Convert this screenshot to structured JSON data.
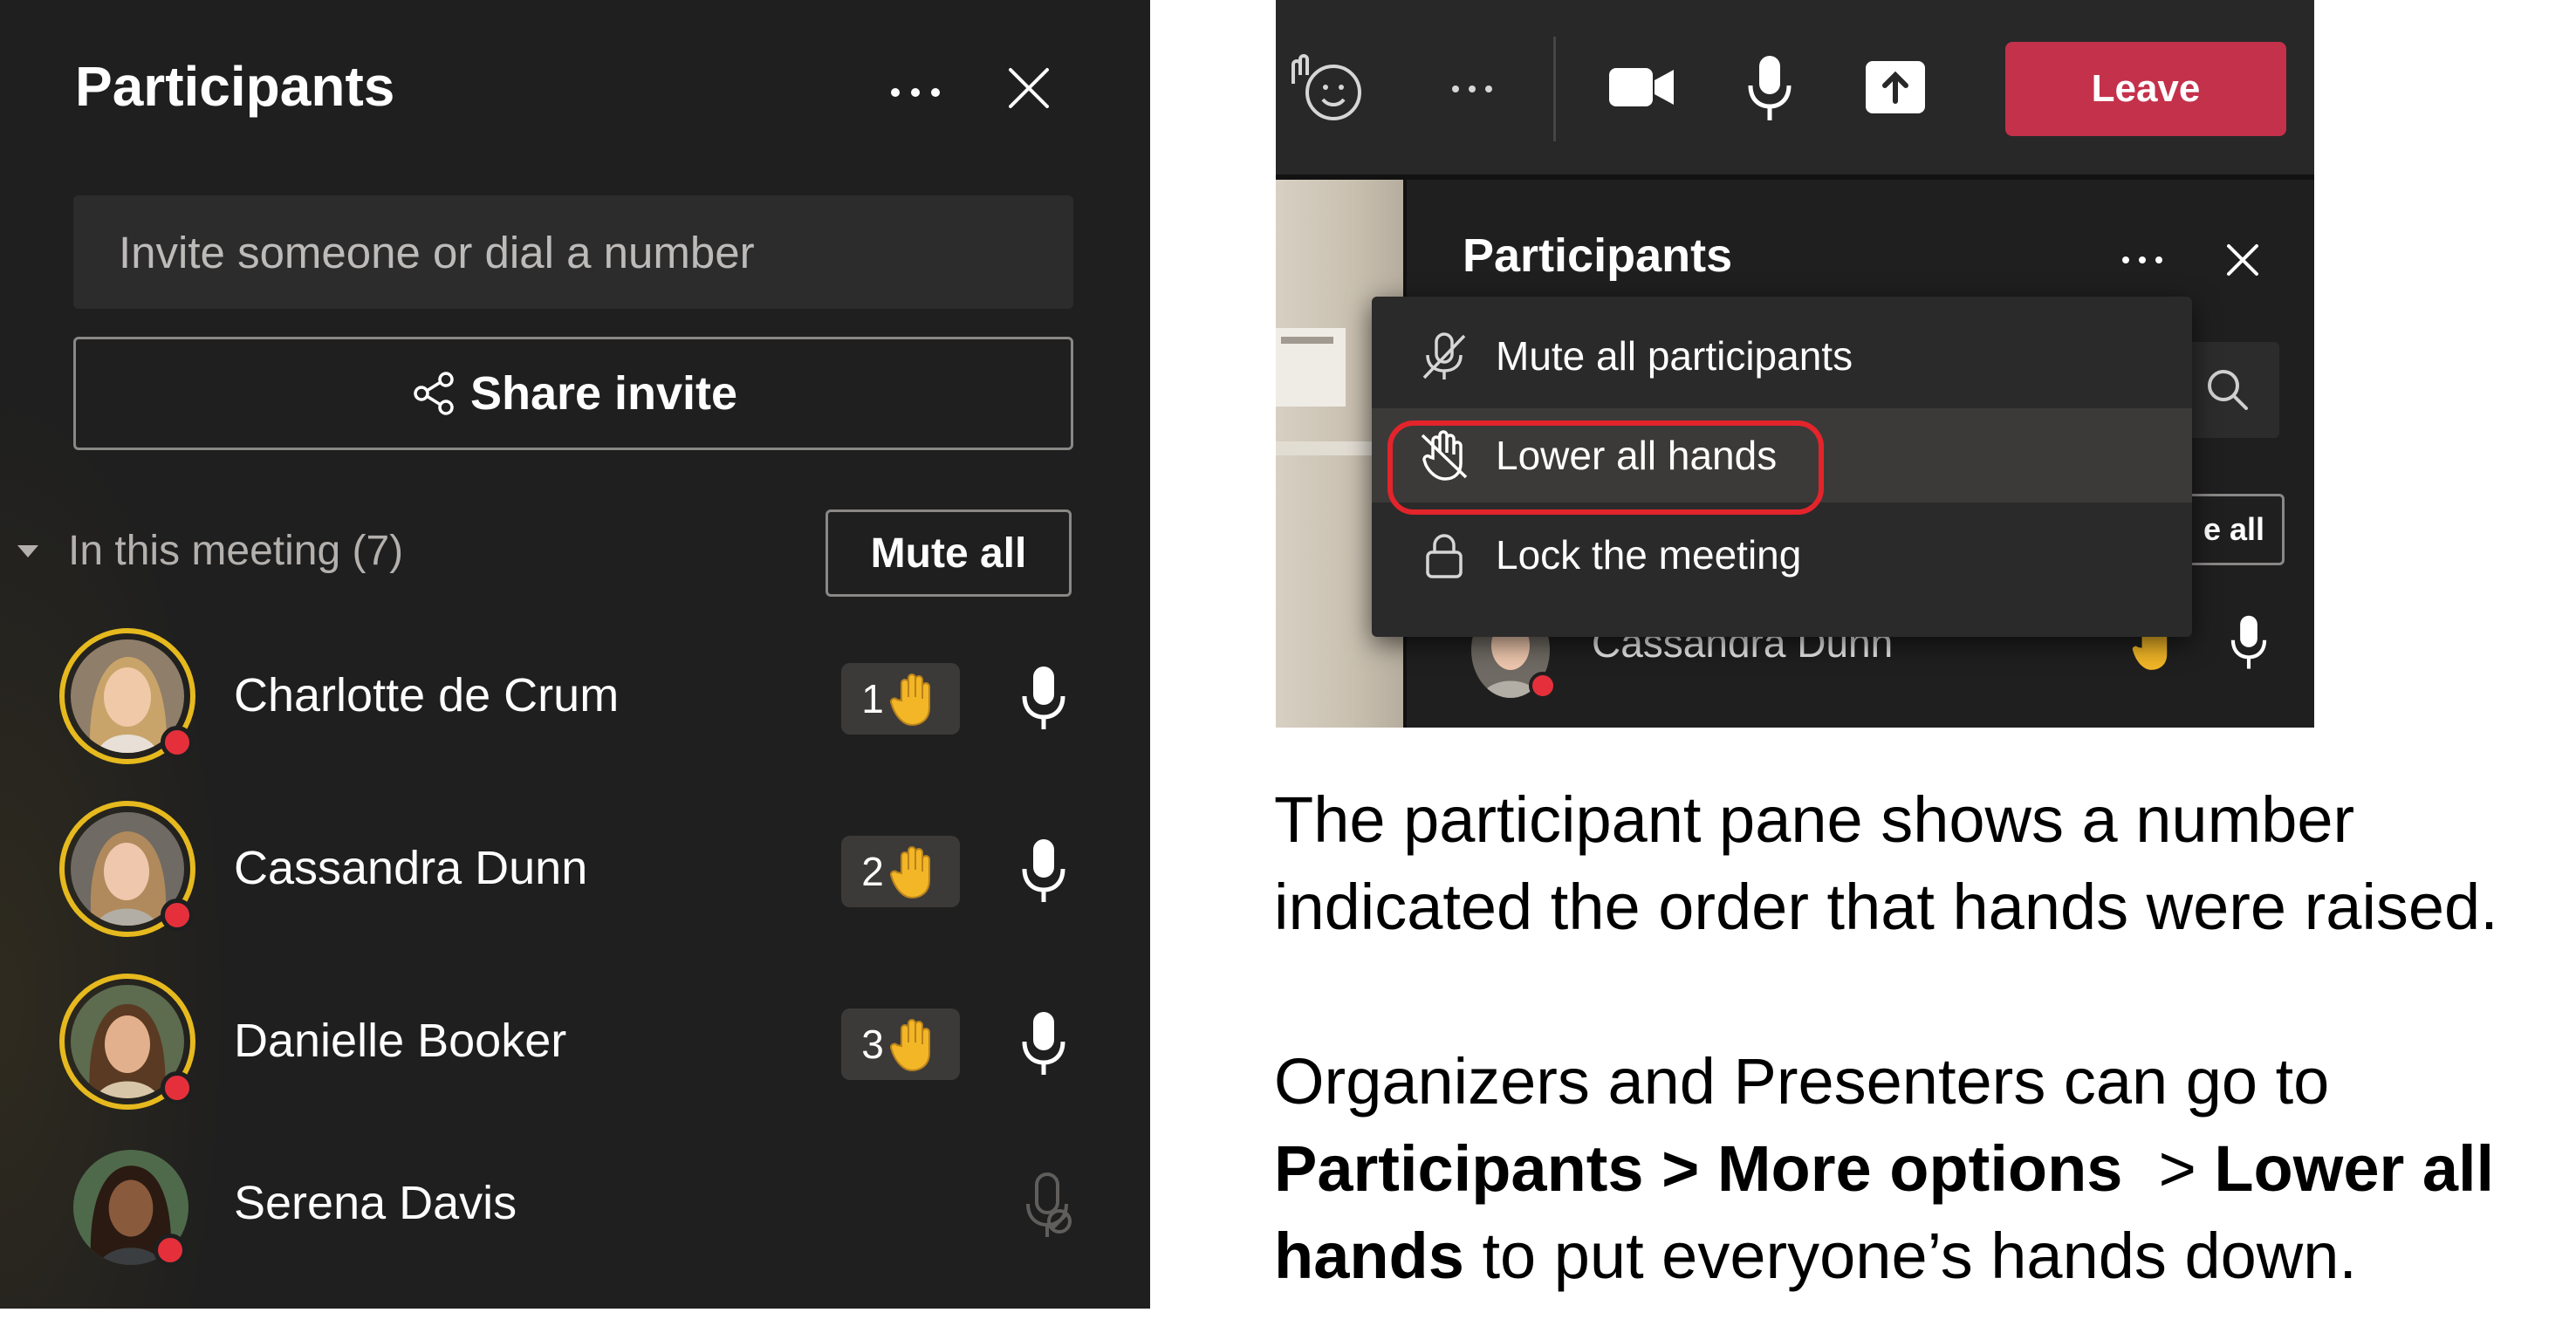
{
  "left_panel": {
    "title": "Participants",
    "invite_placeholder": "Invite someone or dial a number",
    "share_label": "Share invite",
    "section_label": "In this meeting (7)",
    "mute_all_label": "Mute all",
    "participants": [
      {
        "name": "Charlotte de Crum",
        "hand_order": "1",
        "hand_raised": true,
        "mic": "on"
      },
      {
        "name": "Cassandra Dunn",
        "hand_order": "2",
        "hand_raised": true,
        "mic": "on"
      },
      {
        "name": "Danielle Booker",
        "hand_order": "3",
        "hand_raised": true,
        "mic": "on"
      },
      {
        "name": "Serena Davis",
        "hand_order": "",
        "hand_raised": false,
        "mic": "off"
      }
    ]
  },
  "right_screenshot": {
    "leave_label": "Leave",
    "panel_title": "Participants",
    "menu": {
      "items": [
        {
          "label": "Mute all participants",
          "icon": "mic-off-icon"
        },
        {
          "label": "Lower all hands",
          "icon": "hand-off-icon",
          "highlighted": true
        },
        {
          "label": "Lock the meeting",
          "icon": "lock-icon"
        }
      ]
    },
    "mute_all_partial": "e all",
    "participant_name": "Cassandra Dunn"
  },
  "caption": {
    "para1": "The participant pane shows a number indicated the order that hands were raised.",
    "para2_prefix": "Organizers and Presenters can go to ",
    "para2_bold1": "Participants > More options",
    "para2_sep": "  > ",
    "para2_bold2": "Lower all hands",
    "para2_suffix": " to put everyone’s hands down."
  },
  "colors": {
    "panel_bg": "#1f1f1f",
    "ring": "#e6b91e",
    "status": "#e5303c",
    "leave": "#c4314b",
    "highlight": "#e3242b",
    "hand": "#f2b627"
  }
}
